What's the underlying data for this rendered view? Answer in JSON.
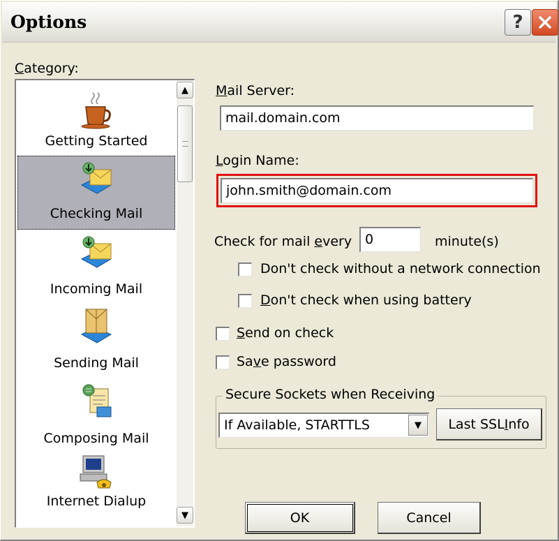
{
  "window": {
    "title": "Options",
    "help_glyph": "?",
    "close_glyph": "✕"
  },
  "category": {
    "label_prefix": "",
    "label_hot": "C",
    "label_rest": "ategory:",
    "items": [
      {
        "label": "Getting Started",
        "icon": "coffee-cup-icon",
        "selected": false
      },
      {
        "label": "Checking Mail",
        "icon": "mail-download-icon",
        "selected": true
      },
      {
        "label": "Incoming Mail",
        "icon": "incoming-mail-icon",
        "selected": false
      },
      {
        "label": "Sending Mail",
        "icon": "sending-mail-icon",
        "selected": false
      },
      {
        "label": "Composing Mail",
        "icon": "composing-mail-icon",
        "selected": false
      },
      {
        "label": "Internet Dialup",
        "icon": "dialup-computer-icon",
        "selected": false
      }
    ],
    "scroll_up": "▲",
    "scroll_down": "▼"
  },
  "form": {
    "mail_server": {
      "hot": "M",
      "rest": "ail Server:",
      "value": "mail.domain.com"
    },
    "login_name": {
      "hot": "L",
      "rest": "ogin Name:",
      "value": "john.smith@domain.com"
    },
    "check_every": {
      "pre": "Check for mail ",
      "hot": "e",
      "post": "very",
      "value": "0",
      "unit": "minute(s)"
    },
    "opt_network": {
      "label": "Don't check without a network connection",
      "checked": false
    },
    "opt_battery": {
      "hot": "D",
      "rest": "on't check when using battery",
      "checked": false
    },
    "send_on_check": {
      "hot": "S",
      "rest": "end on check",
      "checked": false
    },
    "save_password": {
      "pre": "Sa",
      "hot": "v",
      "post": "e password",
      "checked": false
    },
    "ssl_group": {
      "title": "Secure Sockets when Receiving",
      "selected": "If Available, STARTTLS",
      "drop_glyph": "▼",
      "info_pre": "Last SSL ",
      "info_hot": "I",
      "info_post": "nfo"
    }
  },
  "buttons": {
    "ok": "OK",
    "cancel": "Cancel"
  },
  "colors": {
    "highlight": "#e01010",
    "selection": "#b0b0b8",
    "dialog_bg": "#ece9d8"
  }
}
